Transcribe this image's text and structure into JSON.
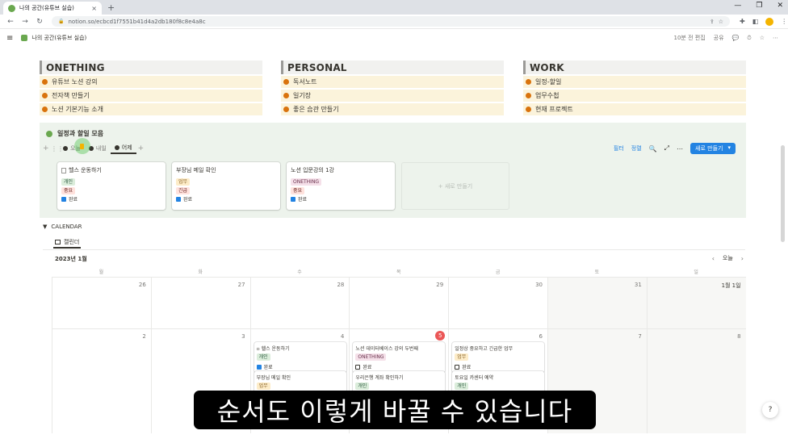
{
  "browser": {
    "tab_title": "나의 공간(유튜브 실습)",
    "tab_close": "×",
    "new_tab": "+",
    "window_controls": [
      "—",
      "❐",
      "✕"
    ],
    "nav": {
      "back": "←",
      "forward": "→",
      "reload": "↻"
    },
    "url": "notion.so/ecbcd1f7551b41d4a2db180f8c8e4a8c",
    "lock": "🔒"
  },
  "topbar": {
    "menu": "≡",
    "breadcrumb": "나의 공간(유튜브 실습)",
    "edited": "10분 전 편집",
    "share": "공유",
    "icons": [
      "💬",
      "⏱",
      "☆",
      "⋯"
    ]
  },
  "categories": [
    {
      "title": "ONETHING",
      "items": [
        "유튜브 노션 강의",
        "전자책 만들기",
        "노션 기본기능 소개"
      ]
    },
    {
      "title": "PERSONAL",
      "items": [
        "독서노트",
        "일기장",
        "좋은 습관 만들기"
      ]
    },
    {
      "title": "WORK",
      "items": [
        "일정-할일",
        "업무수첩",
        "현재 프로젝트"
      ]
    }
  ],
  "db": {
    "title": "일정과 할일 모음",
    "views": [
      "오늘",
      "내일",
      "어제"
    ],
    "add_view": "+",
    "tools": {
      "filter": "필터",
      "sort": "정렬",
      "search": "🔍",
      "expand": "⤢",
      "more": "⋯"
    },
    "new_button": "새로 만들기",
    "new_button_caret": "▾",
    "cards": [
      {
        "title": "헬스 운동하기",
        "tags": [
          {
            "text": "개인",
            "color": "green"
          },
          {
            "text": "중요",
            "color": "red"
          }
        ],
        "done_label": "완료",
        "done": true
      },
      {
        "title": "부장님 메일 확인",
        "tags": [
          {
            "text": "업무",
            "color": "yellow"
          },
          {
            "text": "긴급",
            "color": "red"
          }
        ],
        "done_label": "완료",
        "done": true
      },
      {
        "title": "노션 입문강의 1강",
        "tags": [
          {
            "text": "ONETHING",
            "color": "pink"
          },
          {
            "text": "중요",
            "color": "red"
          }
        ],
        "done_label": "완료",
        "done": true
      }
    ],
    "ghost_new": "+ 새로 만들기"
  },
  "calendar": {
    "toggle": "▼",
    "section_title": "CALENDAR",
    "view_label": "캘린더",
    "month": "2023년 1월",
    "today_button": "오늘",
    "prev": "‹",
    "next": "›",
    "weekdays": [
      "월",
      "화",
      "수",
      "목",
      "금",
      "토",
      "일"
    ],
    "week1": [
      "26",
      "27",
      "28",
      "29",
      "30",
      "31",
      "1월 1일"
    ],
    "week2": [
      "2",
      "3",
      "4",
      "5",
      "6",
      "7",
      "8"
    ],
    "events": {
      "wed": [
        {
          "title": "헬스 운동하기",
          "tag": "개인",
          "tag_color": "green",
          "check": "완료",
          "done": true
        },
        {
          "title": "부장님 메일 확인",
          "tag": "업무",
          "tag_color": "yellow"
        }
      ],
      "thu": [
        {
          "title": "노션 데이터베이스 강의 두번째",
          "tag": "ONETHING",
          "tag_color": "pink",
          "check": "완료",
          "done": false
        },
        {
          "title": "우리은행 계좌 확인하기",
          "tag": "개인",
          "tag_color": "green"
        }
      ],
      "fri": [
        {
          "title": "일정상 중요하고 긴급한 업무",
          "tag": "업무",
          "tag_color": "yellow",
          "check": "완료",
          "done": false
        },
        {
          "title": "토요일 카센터 예약",
          "tag": "개인",
          "tag_color": "green"
        }
      ]
    }
  },
  "subtitle": "순서도 이렇게 바꿀 수 있습니다",
  "help": "?"
}
